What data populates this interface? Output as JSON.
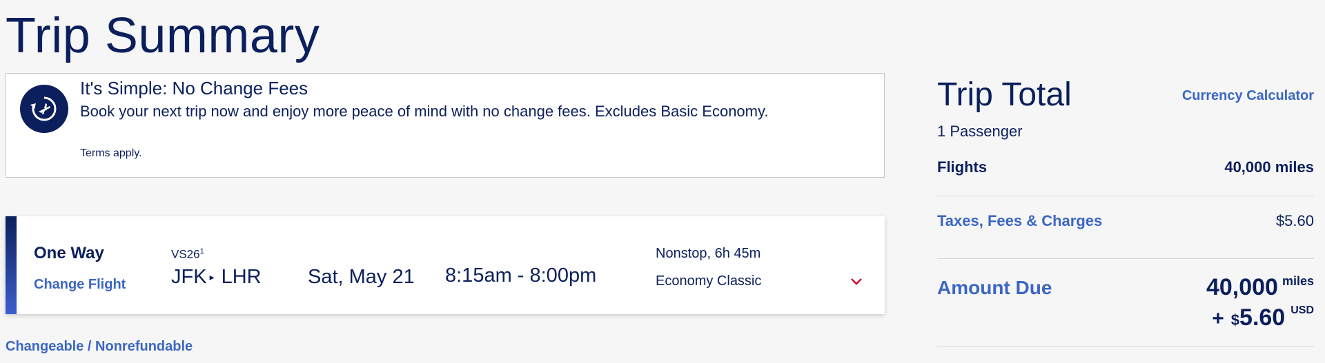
{
  "page": {
    "title": "Trip Summary"
  },
  "banner": {
    "title": "It's Simple: No Change Fees",
    "text": "Book your next trip now and enjoy more peace of mind with no change fees. Excludes Basic Economy.",
    "terms": "Terms apply.",
    "icon": "plane-circle-arrow-icon"
  },
  "flight": {
    "trip_type": "One Way",
    "change_label": "Change Flight",
    "flight_number": "VS26",
    "footnote": "1",
    "origin": "JFK",
    "destination": "LHR",
    "date": "Sat, May 21",
    "time": "8:15am - 8:00pm",
    "stops": "Nonstop, 6h 45m",
    "cabin": "Economy Classic"
  },
  "fare_note": "Changeable / Nonrefundable",
  "summary": {
    "title": "Trip Total",
    "currency_calculator": "Currency Calculator",
    "passengers": "1 Passenger",
    "flights_label": "Flights",
    "flights_value": "40,000 miles",
    "taxes_label": "Taxes, Fees & Charges",
    "taxes_value": "$5.60",
    "amount_due_label": "Amount Due",
    "due_miles": "40,000",
    "due_miles_unit": "miles",
    "due_plus": "+",
    "due_currency_symbol": "$",
    "due_cash": "5.60",
    "due_cash_unit": "USD"
  },
  "colors": {
    "navy": "#0b1f5c",
    "link_blue": "#3b66c4",
    "chevron_red": "#c8102e"
  }
}
